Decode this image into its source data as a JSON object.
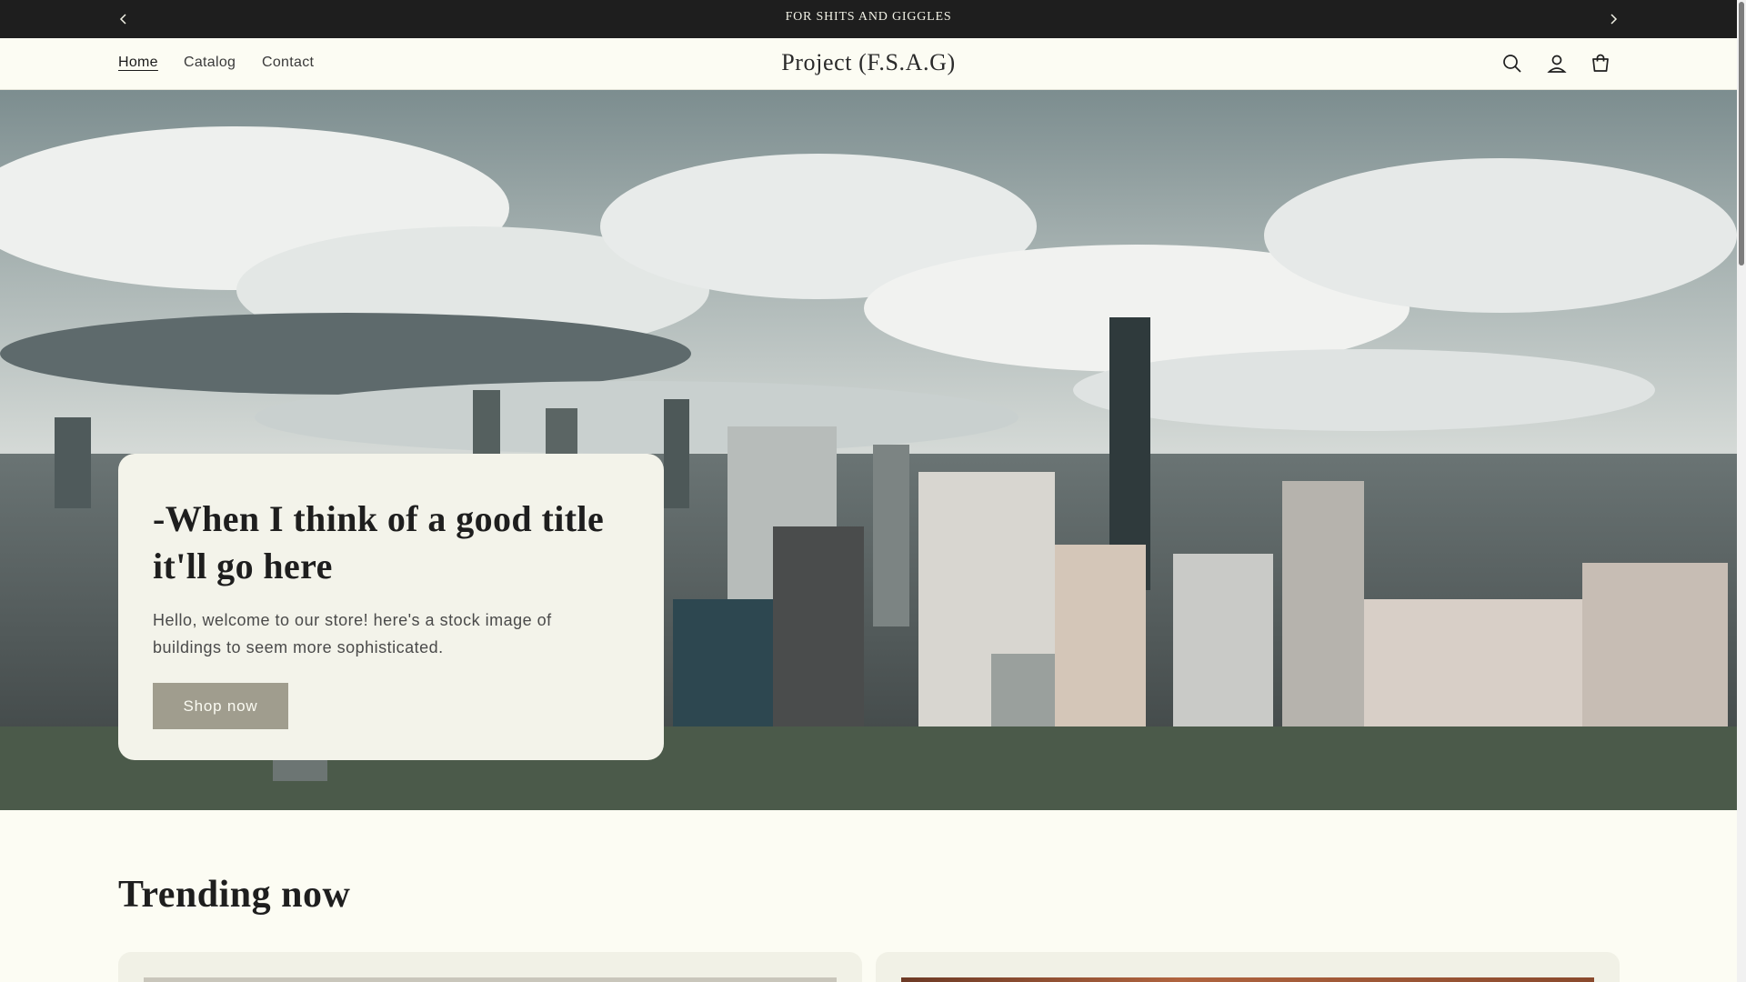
{
  "announcement": {
    "message": "FOR SHITS AND GIGGLES",
    "prev_icon": "chevron-left-icon",
    "next_icon": "chevron-right-icon"
  },
  "header": {
    "nav": [
      {
        "label": "Home",
        "active": true
      },
      {
        "label": "Catalog",
        "active": false
      },
      {
        "label": "Contact",
        "active": false
      }
    ],
    "logo": "Project (F.S.A.G)",
    "icons": [
      "search-icon",
      "account-icon",
      "cart-icon"
    ]
  },
  "hero": {
    "image": "city-skyline-photo",
    "title": "-When I think of a good title it'll go here",
    "text": "Hello, welcome to our store! here's a stock image of buildings to seem more sophisticated.",
    "button_label": "Shop now"
  },
  "trending": {
    "title": "Trending now"
  },
  "colors": {
    "announcement_bg": "#1e1e1e",
    "page_bg": "#fcfcf3",
    "card_bg": "#f3f3ea",
    "button_bg": "#a09d8e"
  }
}
